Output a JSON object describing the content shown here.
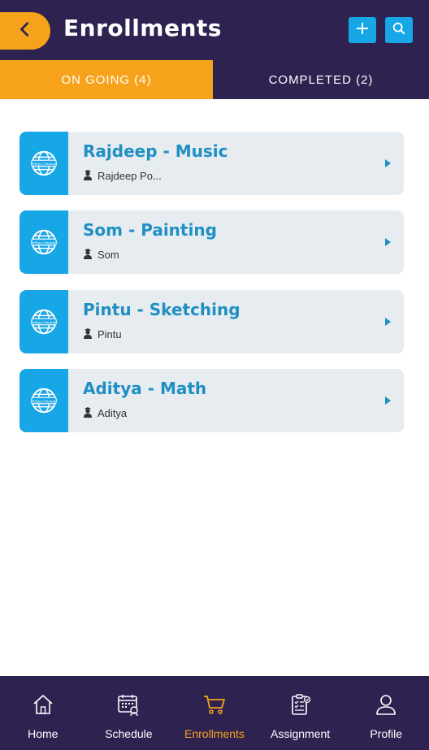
{
  "header": {
    "title": "Enrollments",
    "back_icon": "chevron-left-icon",
    "add_icon": "plus-icon",
    "search_icon": "search-icon"
  },
  "tabs": [
    {
      "label": "ON GOING (4)",
      "active": true
    },
    {
      "label": "COMPLETED (2)",
      "active": false
    }
  ],
  "enrollments": [
    {
      "title": "Rajdeep - Music",
      "teacher": "Rajdeep Po..."
    },
    {
      "title": "Som - Painting",
      "teacher": "Som"
    },
    {
      "title": "Pintu - Sketching",
      "teacher": "Pintu"
    },
    {
      "title": "Aditya - Math",
      "teacher": "Aditya"
    }
  ],
  "bottom_nav": [
    {
      "label": "Home",
      "icon": "home-icon",
      "active": false
    },
    {
      "label": "Schedule",
      "icon": "calendar-icon",
      "active": false
    },
    {
      "label": "Enrollments",
      "icon": "cart-icon",
      "active": true
    },
    {
      "label": "Assignment",
      "icon": "clipboard-icon",
      "active": false
    },
    {
      "label": "Profile",
      "icon": "user-icon",
      "active": false
    }
  ],
  "colors": {
    "primary_dark": "#2e2250",
    "accent_orange": "#f7a21b",
    "accent_blue": "#17a6e6",
    "card_bg": "#e6ecef",
    "title_blue": "#1f8ec4"
  }
}
